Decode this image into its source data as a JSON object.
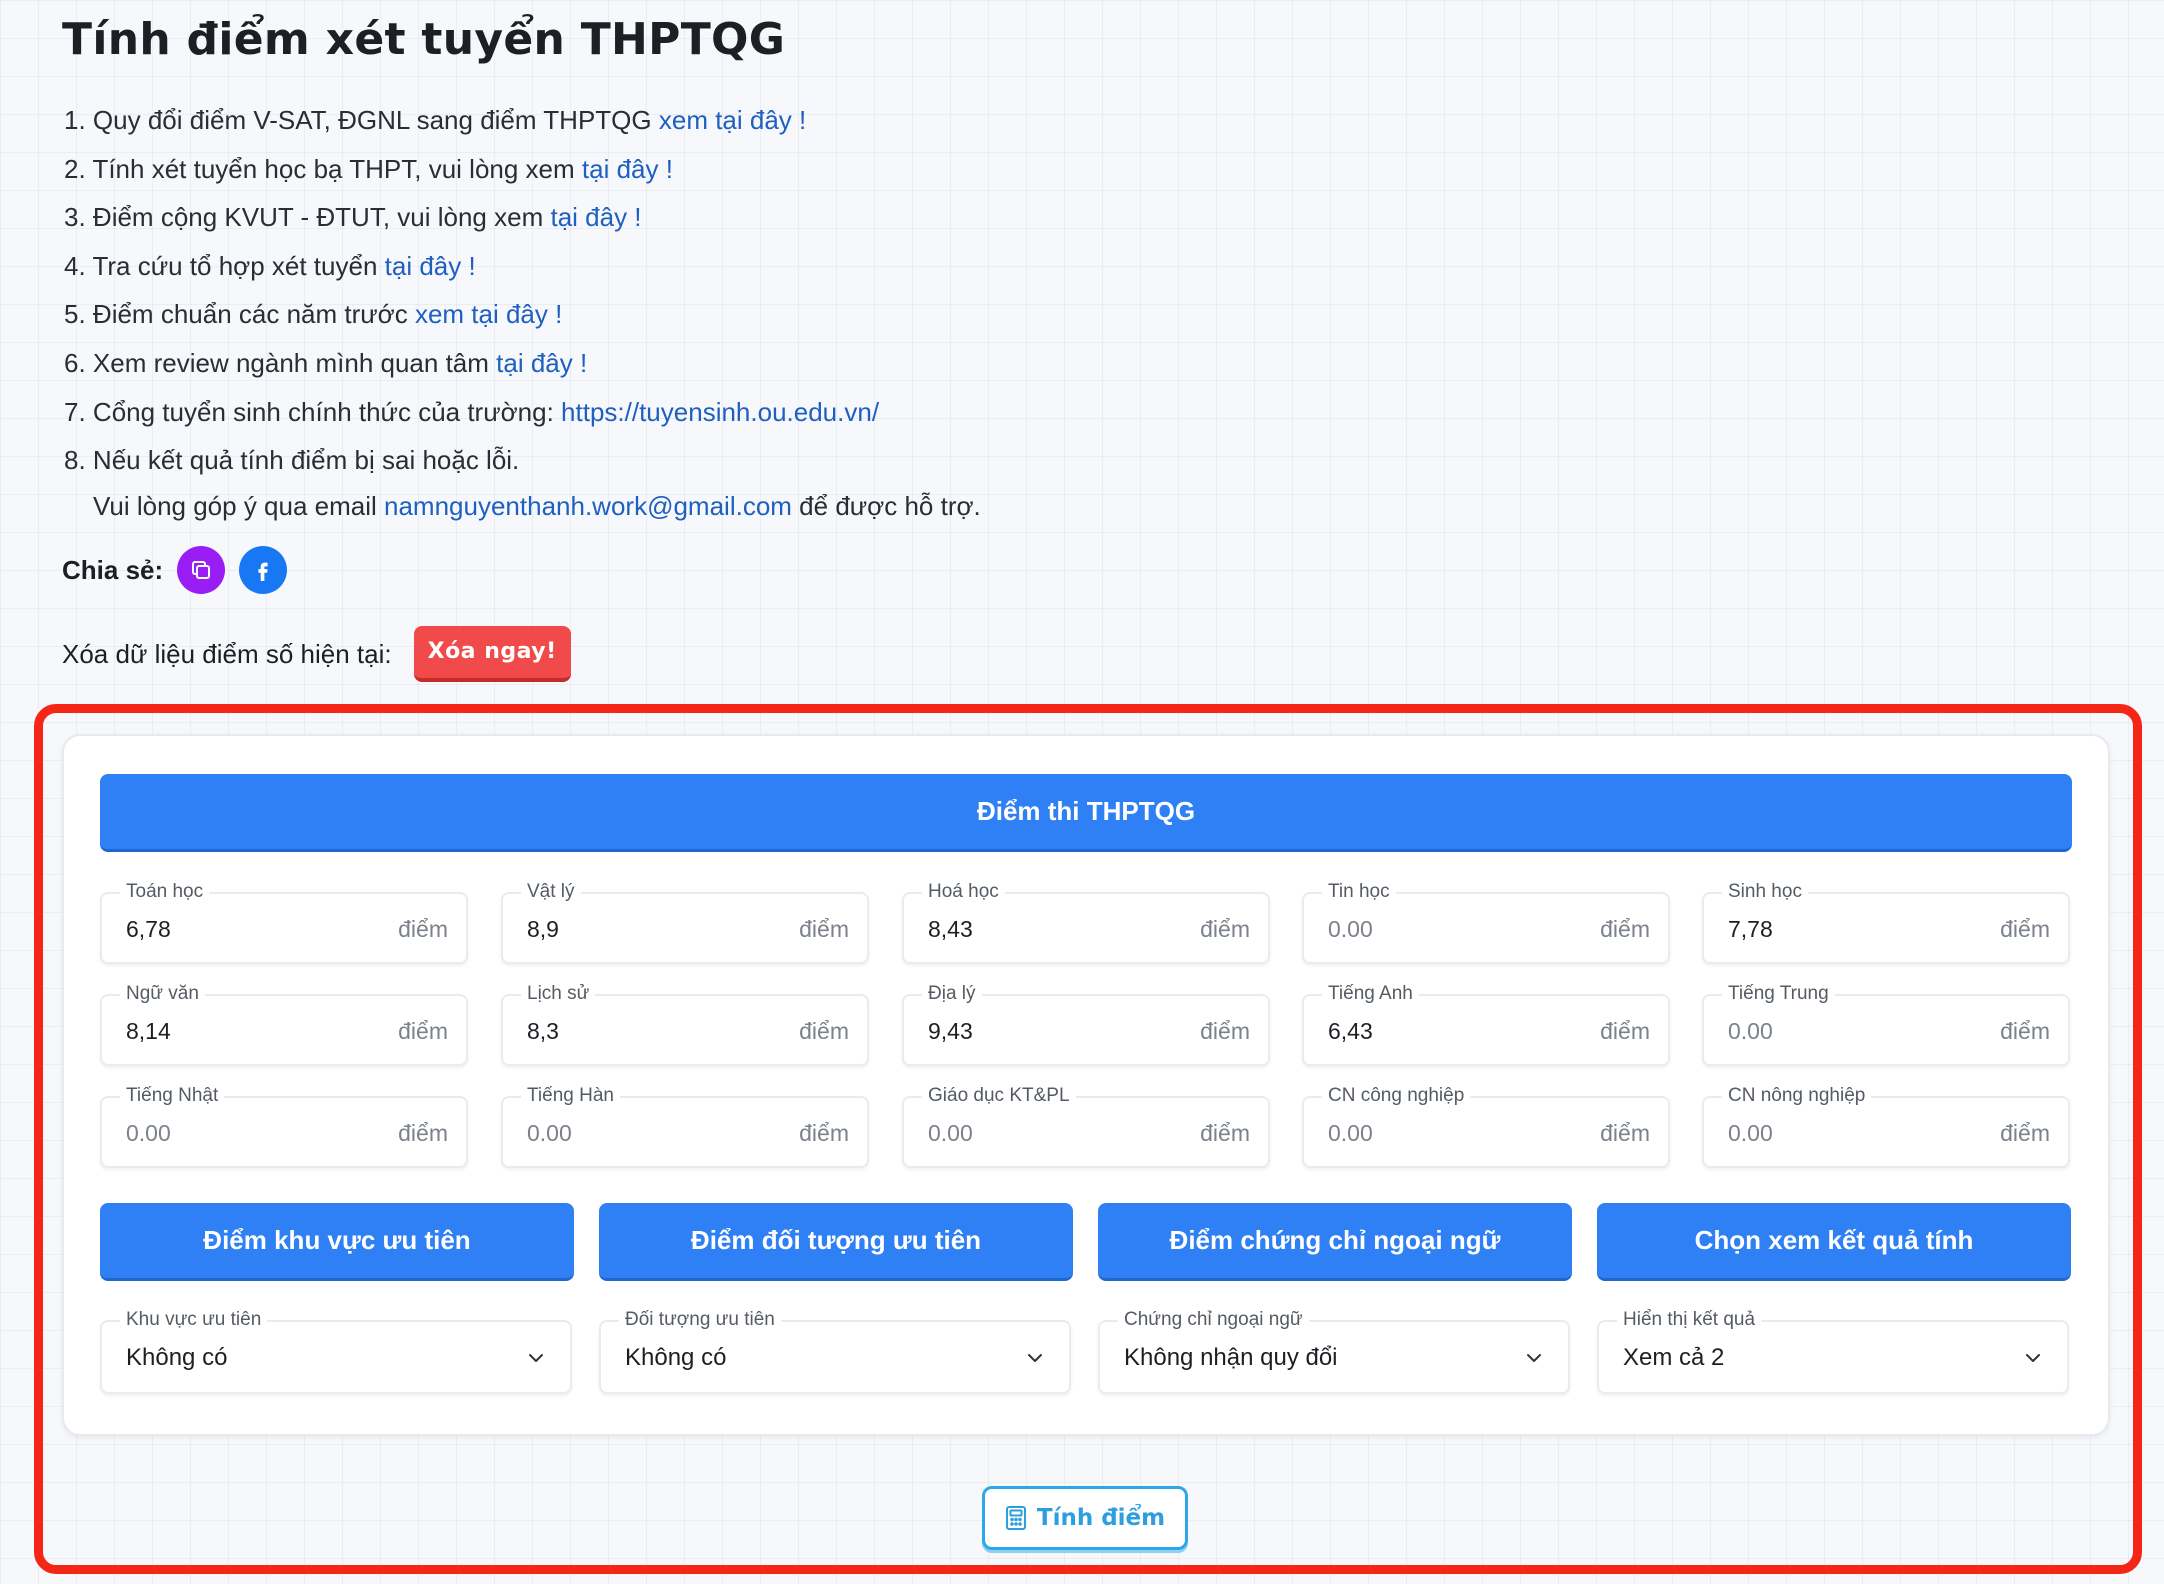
{
  "page": {
    "title": "Tính điểm xét tuyển THPTQG"
  },
  "info": [
    {
      "num": "1.",
      "text": "Quy đổi điểm V-SAT, ĐGNL sang điểm THPTQG ",
      "link": "xem tại đây !"
    },
    {
      "num": "2.",
      "text": "Tính xét tuyển học bạ THPT, vui lòng xem ",
      "link": "tại đây !"
    },
    {
      "num": "3.",
      "text": "Điểm cộng KVUT - ĐTUT, vui lòng xem ",
      "link": "tại đây !"
    },
    {
      "num": "4.",
      "text": "Tra cứu tổ hợp xét tuyển ",
      "link": "tại đây !"
    },
    {
      "num": "5.",
      "text": "Điểm chuẩn các năm trước ",
      "link": "xem tại đây !"
    },
    {
      "num": "6.",
      "text": "Xem review ngành mình quan tâm ",
      "link": "tại đây !"
    },
    {
      "num": "7.",
      "text": "Cổng tuyển sinh chính thức của trường: ",
      "link": "https://tuyensinh.ou.edu.vn/"
    },
    {
      "num": "8.",
      "text": "Nếu kết quả tính điểm bị sai hoặc lỗi.",
      "cont_before": "Vui lòng góp ý qua email ",
      "email": "namnguyenthanh.work@gmail.com",
      "cont_after": " để được hỗ trợ."
    }
  ],
  "share": {
    "label": "Chia sẻ:",
    "icons": [
      "copy-icon",
      "facebook-icon"
    ]
  },
  "clear": {
    "label": "Xóa dữ liệu điểm số hiện tại:",
    "button": "Xóa ngay!"
  },
  "exam": {
    "header": "Điểm thi THPTQG",
    "unit": "điểm",
    "subjects": [
      {
        "label": "Toán học",
        "value": "6,78"
      },
      {
        "label": "Vật lý",
        "value": "8,9"
      },
      {
        "label": "Hoá học",
        "value": "8,43"
      },
      {
        "label": "Tin học",
        "value": "",
        "placeholder": "0.00"
      },
      {
        "label": "Sinh học",
        "value": "7,78"
      },
      {
        "label": "Ngữ văn",
        "value": "8,14"
      },
      {
        "label": "Lịch sử",
        "value": "8,3"
      },
      {
        "label": "Địa lý",
        "value": "9,43"
      },
      {
        "label": "Tiếng Anh",
        "value": "6,43"
      },
      {
        "label": "Tiếng Trung",
        "value": "",
        "placeholder": "0.00"
      },
      {
        "label": "Tiếng Nhật",
        "value": "",
        "placeholder": "0.00"
      },
      {
        "label": "Tiếng Hàn",
        "value": "",
        "placeholder": "0.00"
      },
      {
        "label": "Giáo dục KT&PL",
        "value": "",
        "placeholder": "0.00"
      },
      {
        "label": "CN công nghiệp",
        "value": "",
        "placeholder": "0.00"
      },
      {
        "label": "CN nông nghiệp",
        "value": "",
        "placeholder": "0.00"
      }
    ]
  },
  "sections": [
    {
      "header": "Điểm khu vực ưu tiên",
      "label": "Khu vực ưu tiên",
      "value": "Không có"
    },
    {
      "header": "Điểm đối tượng ưu tiên",
      "label": "Đối tượng ưu tiên",
      "value": "Không có"
    },
    {
      "header": "Điểm chứng chỉ ngoại ngữ",
      "label": "Chứng chỉ ngoại ngữ",
      "value": "Không nhận quy đổi"
    },
    {
      "header": "Chọn xem kết quả tính",
      "label": "Hiển thị kết quả",
      "value": "Xem cả 2"
    }
  ],
  "calc_button": {
    "label": "Tính điểm",
    "icon": "calculator-icon"
  },
  "colors": {
    "primary": "#2f80f5",
    "danger": "#f04a4a",
    "highlight": "#f42716",
    "link": "#1f5fbf",
    "accent": "#2ea7e8"
  }
}
